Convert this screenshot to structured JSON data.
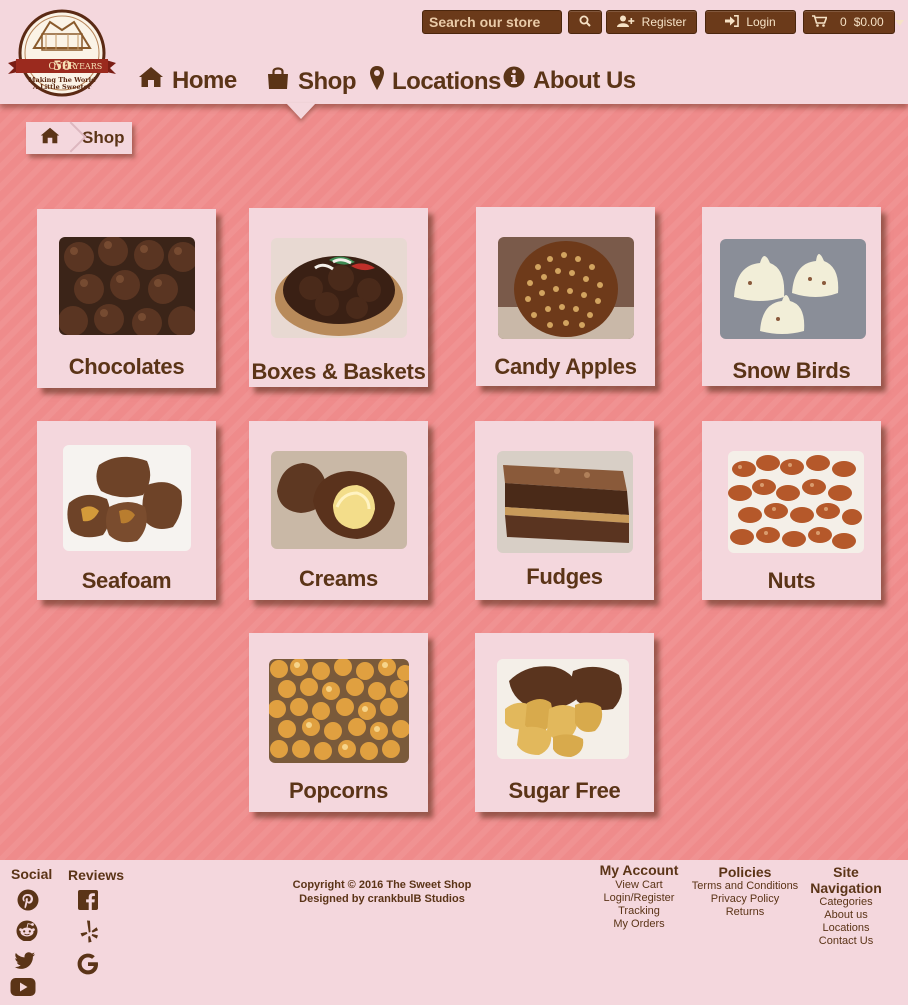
{
  "brand": {
    "logo_top_text": "OVER",
    "logo_number": "50",
    "logo_years": "YEARS",
    "logo_tagline_1": "Making The World",
    "logo_tagline_2": "A Little Sweeter"
  },
  "toolbar": {
    "search_placeholder": "Search our store",
    "register_label": "Register",
    "login_label": "Login",
    "cart_count": "0",
    "cart_total": "$0.00"
  },
  "nav": {
    "items": [
      {
        "label": "Home",
        "icon": "home-icon"
      },
      {
        "label": "Shop",
        "icon": "shopping-bag-icon"
      },
      {
        "label": "Locations",
        "icon": "map-marker-icon"
      },
      {
        "label": "About Us",
        "icon": "info-circle-icon"
      }
    ],
    "active": "Shop"
  },
  "breadcrumb": {
    "home_icon": "home-icon",
    "current": "Shop"
  },
  "categories": [
    {
      "title": "Chocolates",
      "image": "chocolate-balls"
    },
    {
      "title": "Boxes & Baskets",
      "image": "gift-basket"
    },
    {
      "title": "Candy Apples",
      "image": "nut-candy-apple"
    },
    {
      "title": "Snow Birds",
      "image": "white-snow-birds"
    },
    {
      "title": "Seafoam",
      "image": "chocolate-seafoam"
    },
    {
      "title": "Creams",
      "image": "chocolate-creams"
    },
    {
      "title": "Fudges",
      "image": "layered-fudge"
    },
    {
      "title": "Nuts",
      "image": "glazed-nuts"
    },
    {
      "title": "Popcorns",
      "image": "caramel-popcorn"
    },
    {
      "title": "Sugar Free",
      "image": "sugar-free-turtles"
    }
  ],
  "footer": {
    "social_heading": "Social",
    "reviews_heading": "Reviews",
    "social_icons": [
      "pinterest-icon",
      "reddit-icon",
      "twitter-icon",
      "youtube-icon"
    ],
    "review_icons": [
      "facebook-icon",
      "yelp-icon",
      "google-icon"
    ],
    "copyright_line1": "Copyright ©  2016 The Sweet Shop",
    "copyright_line2": "Designed by crankbulB Studios",
    "my_account": {
      "heading": "My Account",
      "links": [
        "View Cart",
        "Login/Register",
        "Tracking",
        "My Orders"
      ]
    },
    "policies": {
      "heading": "Policies",
      "links": [
        "Terms and Conditions",
        "Privacy Policy",
        "Returns"
      ]
    },
    "site_navigation": {
      "heading": "Site Navigation",
      "links": [
        "Categories",
        "About us",
        "Locations",
        "Contact Us"
      ]
    }
  },
  "colors": {
    "background_main": "#ef8b8b",
    "panel": "#f4d7dd",
    "brown": "#5b3417",
    "button": "#6b3a1a"
  }
}
